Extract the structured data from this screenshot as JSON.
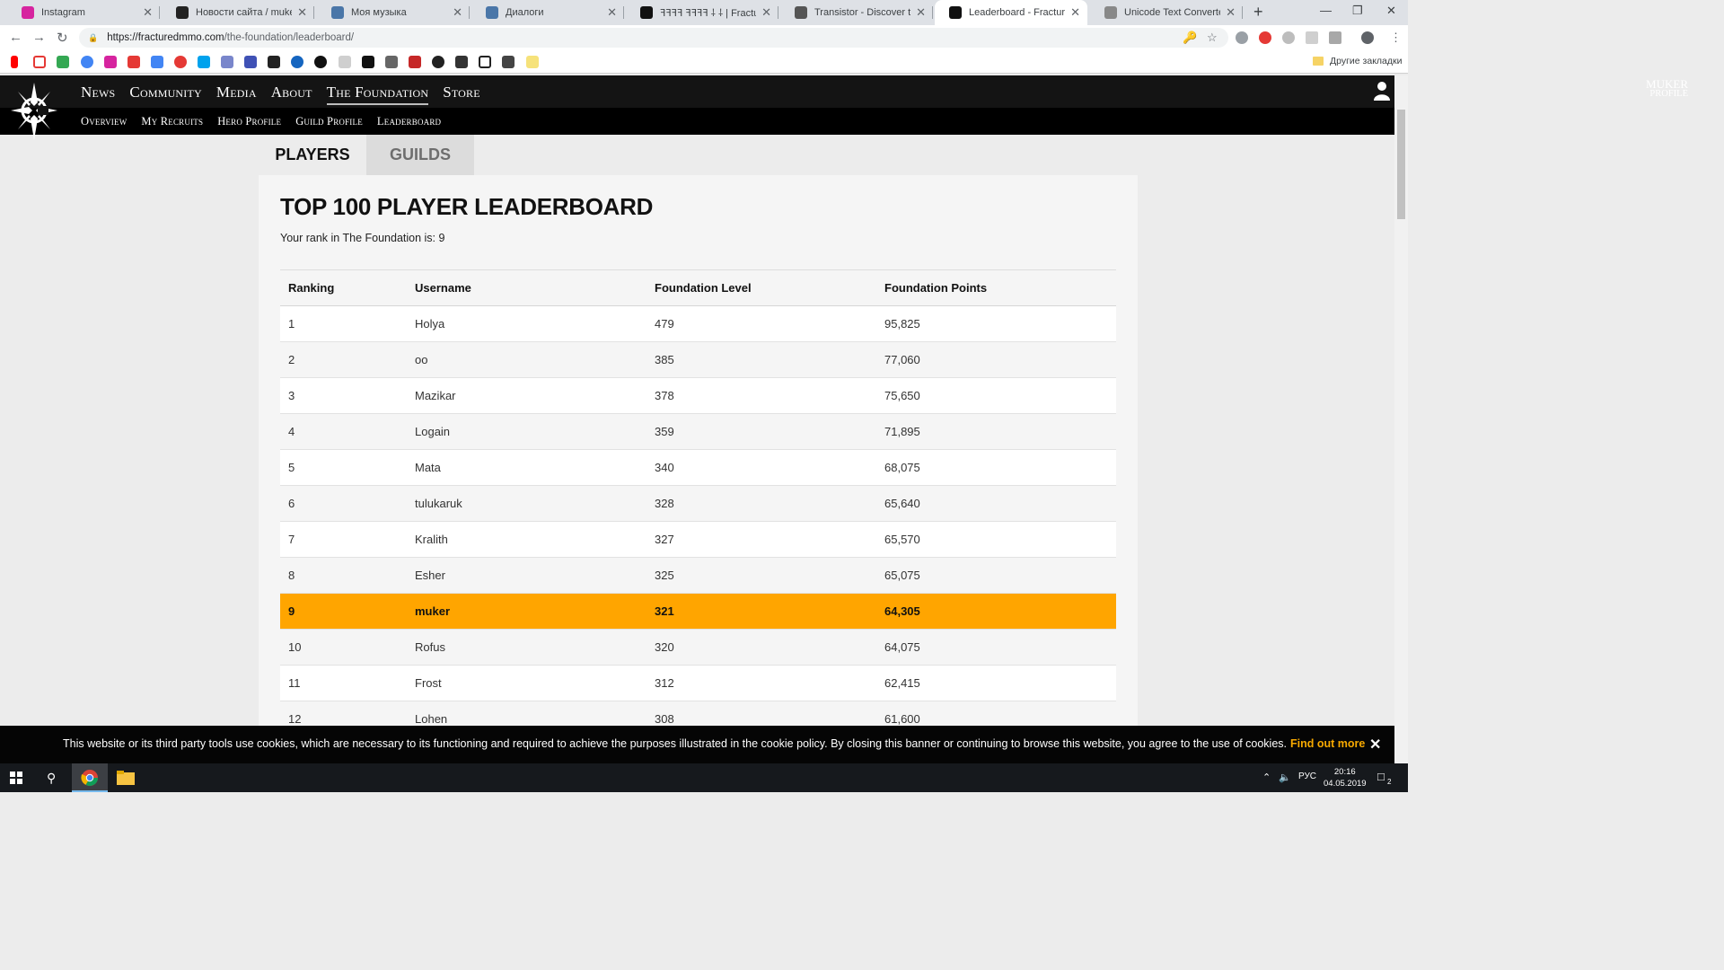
{
  "browser": {
    "tabs": [
      {
        "title": "Instagram",
        "favicon_color": "#d6249f"
      },
      {
        "title": "Новости сайта / muker / П…",
        "favicon_color": "#222222"
      },
      {
        "title": "Моя музыка",
        "favicon_color": "#4a76a8"
      },
      {
        "title": "Диалоги",
        "favicon_color": "#4a76a8"
      },
      {
        "title": "ꟻꟻꟻꟻ ꟻꟻꟻꟻ ⸸ ⸸ | Fracture",
        "favicon_color": "#111111"
      },
      {
        "title": "Transistor - Discover the wo",
        "favicon_color": "#555555"
      },
      {
        "title": "Leaderboard - Fractured - T",
        "favicon_color": "#111111",
        "active": true
      },
      {
        "title": "Unicode Text Converter",
        "favicon_color": "#888888"
      }
    ],
    "new_tab_label": "+",
    "url_host": "https://fracturedmmo.com",
    "url_path": "/the-foundation/leaderboard/",
    "bookmarks_other": "Другие закладки"
  },
  "site": {
    "nav": [
      "News",
      "Community",
      "Media",
      "About",
      "The Foundation",
      "Store"
    ],
    "nav_active": "The Foundation",
    "subnav": [
      "Overview",
      "My Recruits",
      "Hero Profile",
      "Guild Profile",
      "Leaderboard"
    ],
    "profile_name": "MUKER",
    "profile_label": "PROFILE"
  },
  "leaderboard": {
    "tabs": [
      "PLAYERS",
      "GUILDS"
    ],
    "active_tab": "PLAYERS",
    "title": "TOP 100 PLAYER LEADERBOARD",
    "rank_note": "Your rank in The Foundation is: 9",
    "columns": [
      "Ranking",
      "Username",
      "Foundation Level",
      "Foundation Points"
    ],
    "rows": [
      {
        "rank": "1",
        "user": "Holya",
        "level": "479",
        "points": "95,825"
      },
      {
        "rank": "2",
        "user": "oo",
        "level": "385",
        "points": "77,060"
      },
      {
        "rank": "3",
        "user": "Mazikar",
        "level": "378",
        "points": "75,650"
      },
      {
        "rank": "4",
        "user": "Logain",
        "level": "359",
        "points": "71,895"
      },
      {
        "rank": "5",
        "user": "Mata",
        "level": "340",
        "points": "68,075"
      },
      {
        "rank": "6",
        "user": "tulukaruk",
        "level": "328",
        "points": "65,640"
      },
      {
        "rank": "7",
        "user": "Kralith",
        "level": "327",
        "points": "65,570"
      },
      {
        "rank": "8",
        "user": "Esher",
        "level": "325",
        "points": "65,075"
      },
      {
        "rank": "9",
        "user": "muker",
        "level": "321",
        "points": "64,305",
        "highlight": true
      },
      {
        "rank": "10",
        "user": "Rofus",
        "level": "320",
        "points": "64,075"
      },
      {
        "rank": "11",
        "user": "Frost",
        "level": "312",
        "points": "62,415"
      },
      {
        "rank": "12",
        "user": "Lohen",
        "level": "308",
        "points": "61,600"
      }
    ],
    "highlight_color": "#ffa500"
  },
  "cookie": {
    "text": "This website or its third party tools use cookies, which are necessary to its functioning and required to achieve the purposes illustrated in the cookie policy. By closing this banner or continuing to browse this website, you agree to the use of cookies.",
    "link": "Find out more",
    "close": "✕"
  },
  "taskbar": {
    "lang": "РУС",
    "time": "20:16",
    "date": "04.05.2019",
    "notif_count": "2"
  }
}
